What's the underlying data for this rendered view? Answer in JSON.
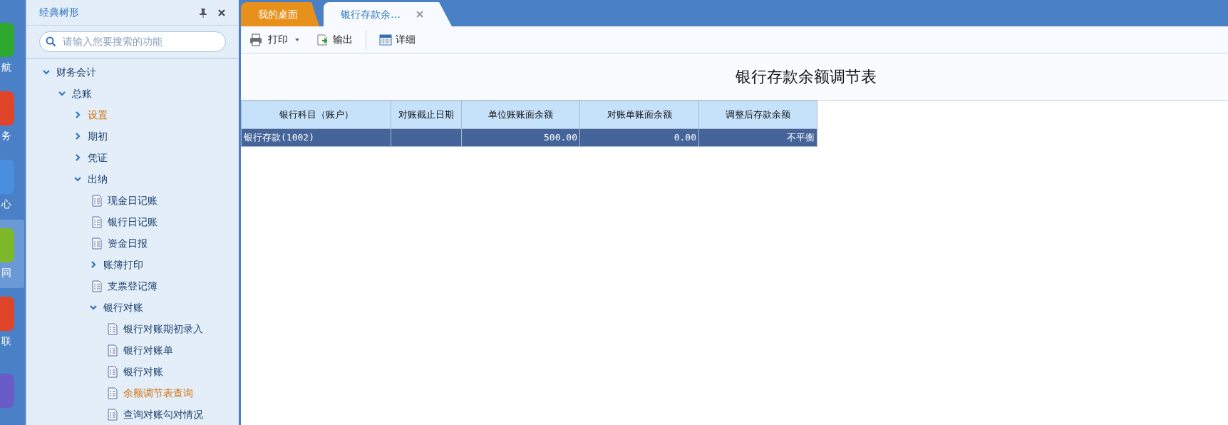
{
  "rail": [
    {
      "label": "航",
      "color": "#2fa82f",
      "selected": false
    },
    {
      "label": "务",
      "color": "#e0452a",
      "selected": false
    },
    {
      "label": "心",
      "color": "#4a8ee0",
      "selected": false
    },
    {
      "label": "同",
      "color": "#7cb82a",
      "selected": true
    },
    {
      "label": "联",
      "color": "#e0452a",
      "selected": false
    },
    {
      "color": "#6a5cc8",
      "selected": false
    }
  ],
  "sidebar": {
    "title": "经典树形",
    "search": {
      "placeholder": "请输入您要搜索的功能"
    },
    "tree": [
      {
        "label": "财务会计",
        "kind": "folder",
        "expanded": true,
        "highlighted": false,
        "children": [
          {
            "label": "总账",
            "kind": "folder",
            "expanded": true,
            "highlighted": false,
            "children": [
              {
                "label": "设置",
                "kind": "folder",
                "expanded": false,
                "highlighted": true
              },
              {
                "label": "期初",
                "kind": "folder",
                "expanded": false,
                "highlighted": false
              },
              {
                "label": "凭证",
                "kind": "folder",
                "expanded": false,
                "highlighted": false
              },
              {
                "label": "出纳",
                "kind": "folder",
                "expanded": true,
                "highlighted": false,
                "children": [
                  {
                    "label": "现金日记账",
                    "kind": "leaf",
                    "highlighted": false
                  },
                  {
                    "label": "银行日记账",
                    "kind": "leaf",
                    "highlighted": false
                  },
                  {
                    "label": "资金日报",
                    "kind": "leaf",
                    "highlighted": false
                  },
                  {
                    "label": "账簿打印",
                    "kind": "folder",
                    "expanded": false,
                    "highlighted": false
                  },
                  {
                    "label": "支票登记簿",
                    "kind": "leaf",
                    "highlighted": false
                  },
                  {
                    "label": "银行对账",
                    "kind": "folder",
                    "expanded": true,
                    "highlighted": false,
                    "children": [
                      {
                        "label": "银行对账期初录入",
                        "kind": "leaf",
                        "highlighted": false
                      },
                      {
                        "label": "银行对账单",
                        "kind": "leaf",
                        "highlighted": false
                      },
                      {
                        "label": "银行对账",
                        "kind": "leaf",
                        "highlighted": false
                      },
                      {
                        "label": "余额调节表查询",
                        "kind": "leaf",
                        "highlighted": true
                      },
                      {
                        "label": "查询对账勾对情况",
                        "kind": "leaf",
                        "highlighted": false
                      }
                    ]
                  }
                ]
              }
            ]
          }
        ]
      }
    ]
  },
  "tabs": [
    {
      "label": "我的桌面",
      "selected": false,
      "closable": false
    },
    {
      "label": "银行存款余…",
      "selected": true,
      "closable": true
    }
  ],
  "toolbar": [
    {
      "label": "打印",
      "kind": "print",
      "dropdown": true
    },
    {
      "label": "输出",
      "kind": "export",
      "dropdown": false
    },
    {
      "label": "详细",
      "kind": "detail",
      "dropdown": false
    }
  ],
  "report": {
    "title": "银行存款余额调节表",
    "columns": [
      "银行科目（账户）",
      "对账截止日期",
      "单位账账面余额",
      "对账单账面余额",
      "调整后存款余额"
    ],
    "rows": [
      {
        "selected": true,
        "cells": [
          "银行存款(1002)",
          "",
          "500.00",
          "0.00",
          "不平衡"
        ]
      }
    ]
  }
}
